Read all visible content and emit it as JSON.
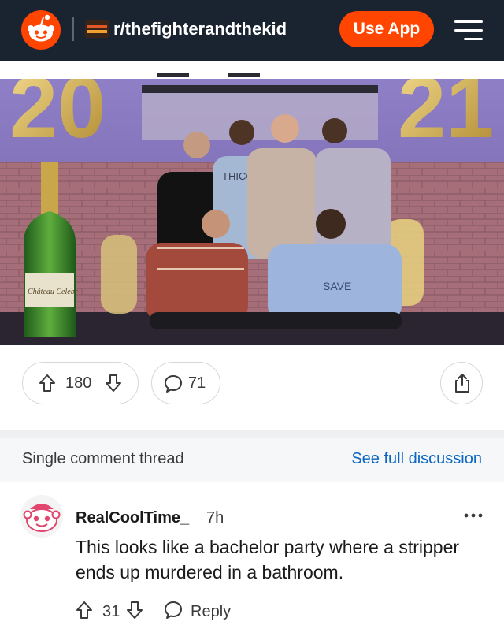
{
  "header": {
    "subreddit": "r/thefighterandthekid",
    "use_app_label": "Use App"
  },
  "post": {
    "image_text": {
      "banner_left": "20",
      "banner_right": "21",
      "bottle_label": "Château Celebr",
      "shirt_text": "THICC BOY",
      "hoodie_text": "SAVE"
    },
    "score": "180",
    "comments": "71"
  },
  "thread": {
    "label": "Single comment thread",
    "full_link": "See full discussion"
  },
  "comment": {
    "author": "RealCoolTime_",
    "time": "7h",
    "body": "This looks like a bachelor party where a stripper ends up murdered in a bathroom.",
    "score": "31",
    "reply_label": "Reply"
  },
  "colors": {
    "header_bg": "#1a2330",
    "accent": "#ff4500",
    "link": "#0a66c2"
  }
}
